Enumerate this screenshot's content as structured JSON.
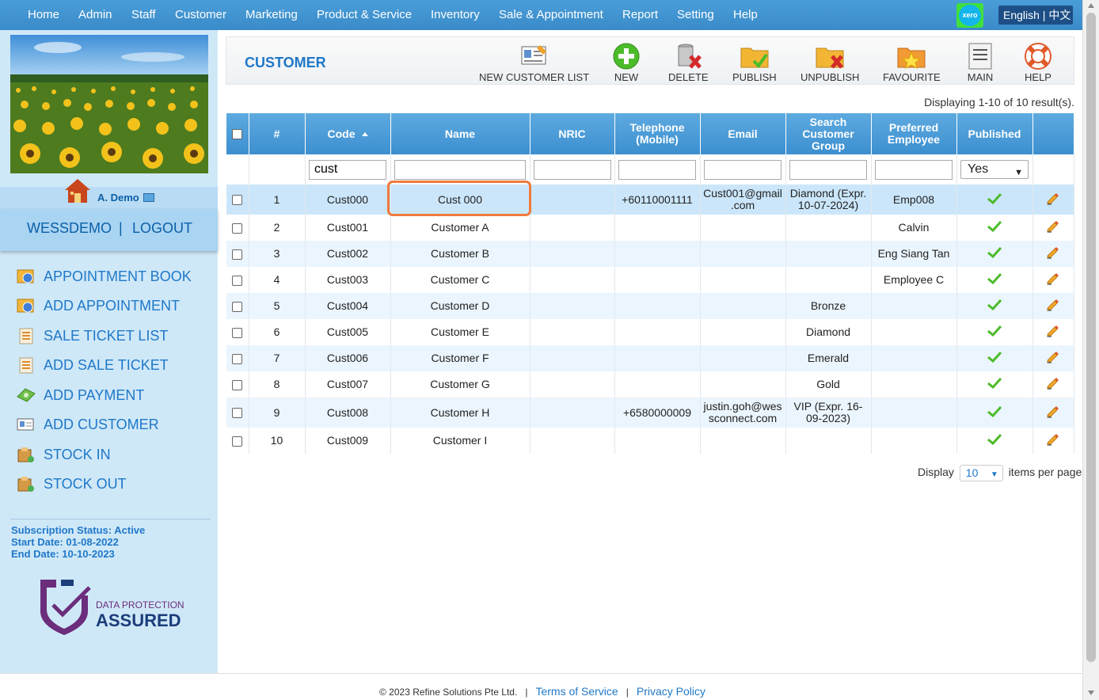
{
  "nav": {
    "items": [
      "Home",
      "Admin",
      "Staff",
      "Customer",
      "Marketing",
      "Product & Service",
      "Inventory",
      "Sale & Appointment",
      "Report",
      "Setting",
      "Help"
    ],
    "xero_label": "xero",
    "language": "English | 中文"
  },
  "sidebar": {
    "user_name": "A. Demo",
    "account": "WESSDEMO",
    "separator": "|",
    "logout": "LOGOUT",
    "menu": [
      {
        "label": "APPOINTMENT BOOK",
        "icon": "appointment-book-icon"
      },
      {
        "label": "ADD APPOINTMENT",
        "icon": "add-appointment-icon"
      },
      {
        "label": "SALE TICKET LIST",
        "icon": "sale-ticket-list-icon"
      },
      {
        "label": "ADD SALE TICKET",
        "icon": "add-sale-ticket-icon"
      },
      {
        "label": "ADD PAYMENT",
        "icon": "add-payment-icon"
      },
      {
        "label": "ADD CUSTOMER",
        "icon": "add-customer-icon"
      },
      {
        "label": "STOCK IN",
        "icon": "stock-in-icon"
      },
      {
        "label": "STOCK OUT",
        "icon": "stock-out-icon"
      }
    ],
    "subscription_status": "Subscription Status: Active",
    "start_date": "Start Date: 01-08-2022",
    "end_date": "End Date: 10-10-2023",
    "badge_top": "DATA PROTECTION",
    "badge_bottom": "ASSURED"
  },
  "toolbar": {
    "title": "CUSTOMER",
    "buttons": [
      "NEW CUSTOMER LIST",
      "NEW",
      "DELETE",
      "PUBLISH",
      "UNPUBLISH",
      "FAVOURITE",
      "MAIN",
      "HELP"
    ]
  },
  "results_text": "Displaying 1-10 of 10 result(s).",
  "table": {
    "headers": {
      "num": "#",
      "code": "Code",
      "name": "Name",
      "nric": "NRIC",
      "tel1": "Telephone",
      "tel2": "(Mobile)",
      "email": "Email",
      "group1": "Search",
      "group2": "Customer",
      "group3": "Group",
      "emp1": "Preferred",
      "emp2": "Employee",
      "published": "Published"
    },
    "filters": {
      "code": "cust",
      "published": "Yes"
    },
    "rows": [
      {
        "num": "1",
        "code": "Cust000",
        "name": "Cust 000",
        "nric": "",
        "tel": "+60110001111",
        "email1": "Cust001@gmail",
        "email2": ".com",
        "group1": "Diamond (Expr.",
        "group2": "10-07-2024)",
        "employee": "Emp008"
      },
      {
        "num": "2",
        "code": "Cust001",
        "name": "Customer A",
        "nric": "",
        "tel": "",
        "email1": "",
        "email2": "",
        "group1": "",
        "group2": "",
        "employee": "Calvin"
      },
      {
        "num": "3",
        "code": "Cust002",
        "name": "Customer B",
        "nric": "",
        "tel": "",
        "email1": "",
        "email2": "",
        "group1": "",
        "group2": "",
        "employee": "Eng Siang Tan"
      },
      {
        "num": "4",
        "code": "Cust003",
        "name": "Customer C",
        "nric": "",
        "tel": "",
        "email1": "",
        "email2": "",
        "group1": "",
        "group2": "",
        "employee": "Employee C"
      },
      {
        "num": "5",
        "code": "Cust004",
        "name": "Customer D",
        "nric": "",
        "tel": "",
        "email1": "",
        "email2": "",
        "group1": "Bronze",
        "group2": "",
        "employee": ""
      },
      {
        "num": "6",
        "code": "Cust005",
        "name": "Customer E",
        "nric": "",
        "tel": "",
        "email1": "",
        "email2": "",
        "group1": "Diamond",
        "group2": "",
        "employee": ""
      },
      {
        "num": "7",
        "code": "Cust006",
        "name": "Customer F",
        "nric": "",
        "tel": "",
        "email1": "",
        "email2": "",
        "group1": "Emerald",
        "group2": "",
        "employee": ""
      },
      {
        "num": "8",
        "code": "Cust007",
        "name": "Customer G",
        "nric": "",
        "tel": "",
        "email1": "",
        "email2": "",
        "group1": "Gold",
        "group2": "",
        "employee": ""
      },
      {
        "num": "9",
        "code": "Cust008",
        "name": "Customer H",
        "nric": "",
        "tel": "+6580000009",
        "email1": "justin.goh@wes",
        "email2": "sconnect.com",
        "group1": "VIP (Expr. 16-",
        "group2": "09-2023)",
        "employee": ""
      },
      {
        "num": "10",
        "code": "Cust009",
        "name": "Customer I",
        "nric": "",
        "tel": "",
        "email1": "",
        "email2": "",
        "group1": "",
        "group2": "",
        "employee": ""
      }
    ]
  },
  "pager": {
    "display_label": "Display",
    "per_page": "10",
    "suffix": "items per page"
  },
  "footer": {
    "copyright": "© 2023 Refine Solutions Pte Ltd.",
    "sep": "|",
    "terms": "Terms of Service",
    "privacy": "Privacy Policy"
  },
  "colors": {
    "nav_bg": "#3a8bc9",
    "sidebar_bg": "#cfe8f8",
    "link_blue": "#1f78c8",
    "highlight": "#f07a3c"
  }
}
